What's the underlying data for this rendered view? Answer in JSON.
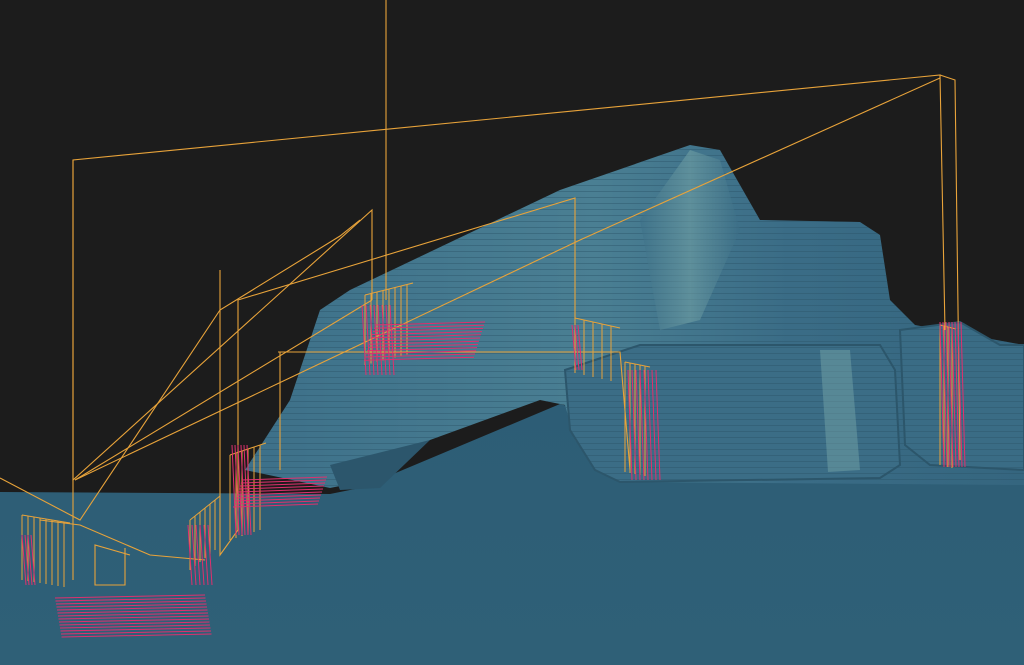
{
  "viewport": {
    "background_color": "#1c1c1c",
    "floor_color": "#2f5f78",
    "part_color": "#3c6f88",
    "part_highlight_color": "#6fa0a8",
    "part_edge_color": "#264a5e",
    "toolpath_link_color": "#e8a33a",
    "toolpath_cut_color": "#e0306e"
  },
  "icons": {
    "model": "workpiece-mesh",
    "toolpath": "toolpath-lines"
  }
}
